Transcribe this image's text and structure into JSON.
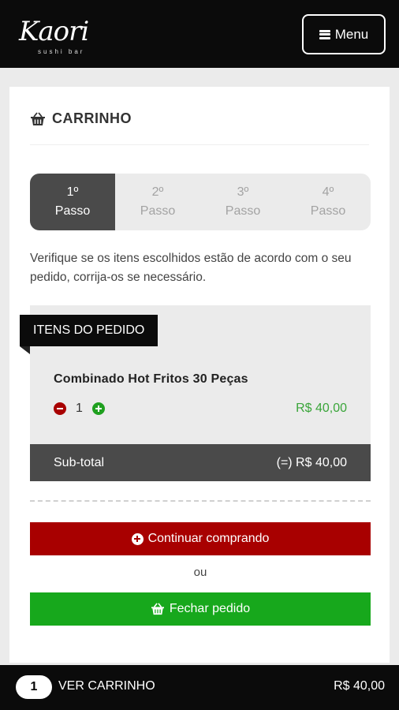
{
  "header": {
    "logo_text": "Kaori",
    "logo_sub": "sushi bar",
    "menu_label": "Menu"
  },
  "cart": {
    "title": "CARRINHO",
    "steps": [
      {
        "number": "1º",
        "label": "Passo",
        "active": true
      },
      {
        "number": "2º",
        "label": "Passo",
        "active": false
      },
      {
        "number": "3º",
        "label": "Passo",
        "active": false
      },
      {
        "number": "4º",
        "label": "Passo",
        "active": false
      }
    ],
    "instructions": "Verifique se os itens escolhidos estão de acordo com o seu pedido, corrija-os se necessário.",
    "items_title": "ITENS DO PEDIDO",
    "items": [
      {
        "name": "Combinado Hot Fritos 30 Peças",
        "quantity": "1",
        "price": "R$ 40,00"
      }
    ],
    "subtotal_label": "Sub-total",
    "subtotal_value": "(=) R$ 40,00",
    "continue_label": "Continuar comprando",
    "or_label": "ou",
    "checkout_label": "Fechar pedido"
  },
  "bottom_bar": {
    "count": "1",
    "view_cart_label": "VER CARRINHO",
    "total": "R$ 40,00"
  },
  "colors": {
    "dark": "#0b0b0b",
    "active_step": "#4a4a4a",
    "continue_red": "#a80000",
    "checkout_green": "#17a81c",
    "price_green": "#3aa53a"
  },
  "icons": [
    "menu-icon",
    "basket-icon",
    "minus-circle-icon",
    "plus-circle-icon"
  ]
}
